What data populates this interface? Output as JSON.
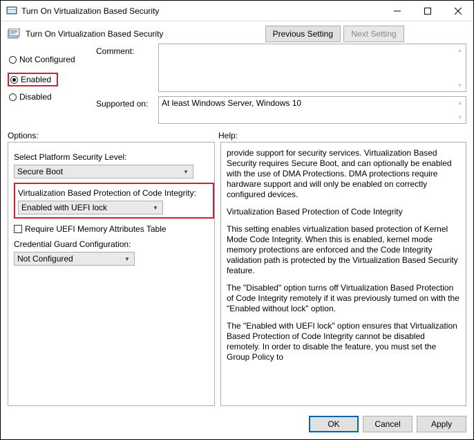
{
  "titlebar": {
    "title": "Turn On Virtualization Based Security"
  },
  "subtitle": "Turn On Virtualization Based Security",
  "nav": {
    "prev": "Previous Setting",
    "next": "Next Setting"
  },
  "radios": {
    "not_configured": "Not Configured",
    "enabled": "Enabled",
    "disabled": "Disabled"
  },
  "labels": {
    "comment": "Comment:",
    "supported_on": "Supported on:",
    "options": "Options:",
    "help": "Help:"
  },
  "supported_on_value": "At least Windows Server, Windows 10",
  "options": {
    "platform_label": "Select Platform Security Level:",
    "platform_value": "Secure Boot",
    "vbp_label": "Virtualization Based Protection of Code Integrity:",
    "vbp_value": "Enabled with UEFI lock",
    "require_uefi_mat": "Require UEFI Memory Attributes Table",
    "credguard_label": "Credential Guard Configuration:",
    "credguard_value": "Not Configured"
  },
  "help": {
    "p1": "provide support for security services. Virtualization Based Security requires Secure Boot, and can optionally be enabled with the use of DMA Protections. DMA protections require hardware support and will only be enabled on correctly configured devices.",
    "p2": "Virtualization Based Protection of Code Integrity",
    "p3": "This setting enables virtualization based protection of Kernel Mode Code Integrity. When this is enabled, kernel mode memory protections are enforced and the Code Integrity validation path is protected by the Virtualization Based Security feature.",
    "p4": "The \"Disabled\" option turns off Virtualization Based Protection of Code Integrity remotely if it was previously turned on with the \"Enabled without lock\" option.",
    "p5": "The \"Enabled with UEFI lock\" option ensures that Virtualization Based Protection of Code Integrity cannot be disabled remotely. In order to disable the feature, you must set the Group Policy to"
  },
  "footer": {
    "ok": "OK",
    "cancel": "Cancel",
    "apply": "Apply"
  }
}
